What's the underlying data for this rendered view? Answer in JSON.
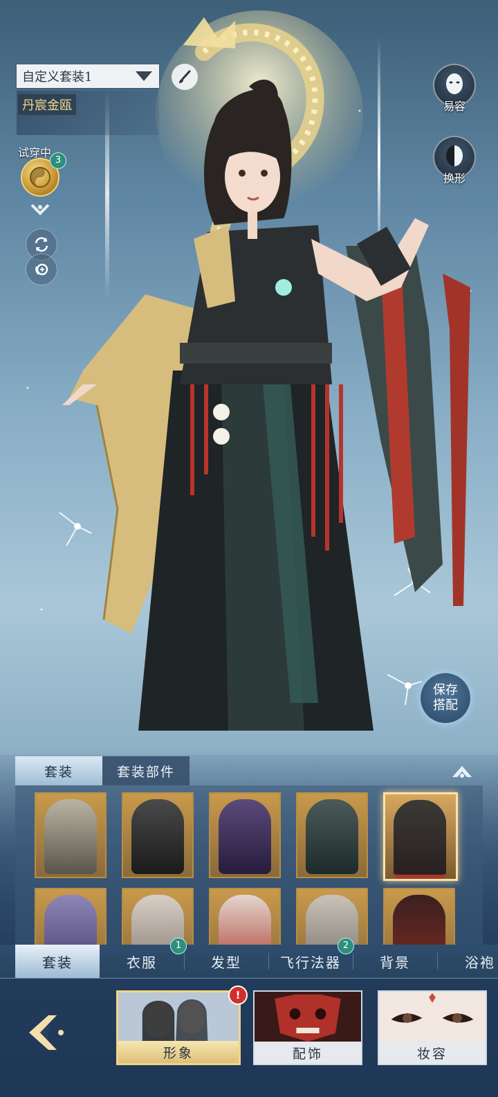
{
  "outfit_selector": {
    "current": "自定义套装1"
  },
  "outfit_name": "丹宸金瓯",
  "trying_on": {
    "label": "试穿中",
    "count": "3"
  },
  "right_buttons": {
    "face": "易容",
    "transform": "换形"
  },
  "save_button": {
    "line1": "保存",
    "line2": "搭配"
  },
  "subtabs": [
    {
      "label": "套装"
    },
    {
      "label": "套装部件"
    }
  ],
  "outfit_grid": {
    "rows": 2,
    "columns": 5,
    "selected_index": 4
  },
  "category_tabs": [
    {
      "label": "套装",
      "badge": ""
    },
    {
      "label": "衣服",
      "badge": "1"
    },
    {
      "label": "发型",
      "badge": ""
    },
    {
      "label": "飞行法器",
      "badge": "2"
    },
    {
      "label": "背景",
      "badge": ""
    },
    {
      "label": "浴袍",
      "badge": ""
    }
  ],
  "bottom_nav": [
    {
      "label": "形象"
    },
    {
      "label": "配饰"
    },
    {
      "label": "妆容"
    }
  ],
  "bottom_alert": "!",
  "colors": {
    "accent_gold": "#f0d48a",
    "badge_teal": "#2f8f7e",
    "alert_red": "#d0302a"
  }
}
